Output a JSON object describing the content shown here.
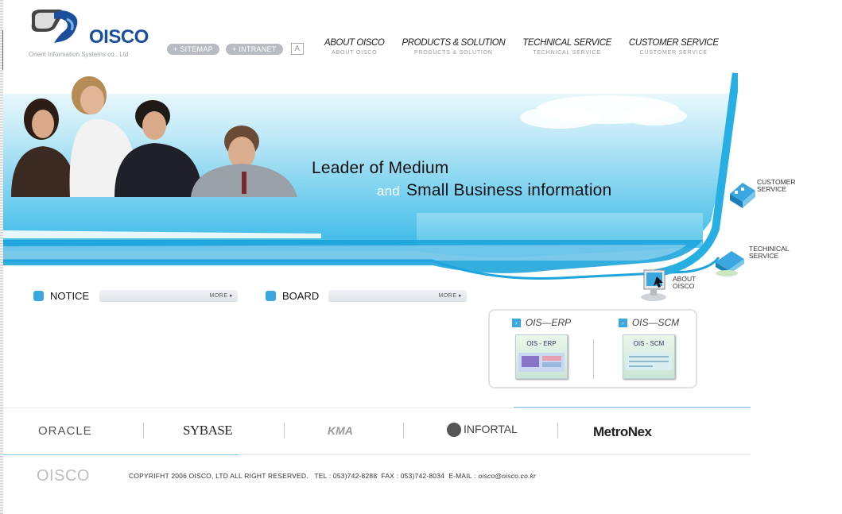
{
  "brand": {
    "name": "OISCO",
    "subtitle": "Orient Information Systems co., Ltd",
    "primary_color": "#1b4f9c",
    "accent_color": "#3aa7e0"
  },
  "utility": {
    "sitemap": "+ SITEMAP",
    "intranet": "+ INTRANET",
    "font_size_button": "A"
  },
  "nav": [
    {
      "label": "ABOUT OISCO",
      "sub": "ABOUT OISCO"
    },
    {
      "label": "PRODUCTS & SOLUTION",
      "sub": "PRODUCTS & SOLUTION"
    },
    {
      "label": "TECHNICAL SERVICE",
      "sub": "TECHNICAL SERVICE"
    },
    {
      "label": "CUSTOMER SERVICE",
      "sub": "CUSTOMER SERVICE"
    }
  ],
  "hero": {
    "line1": "Leader of Medium",
    "and": "and",
    "line2": "Small Business information"
  },
  "quick_links": {
    "customer": [
      "CUSTOMER",
      "SERVICE"
    ],
    "technical": [
      "TECHINICAL",
      "SERVICE"
    ],
    "about": [
      "ABOUT",
      "OISCO"
    ]
  },
  "boards": {
    "notice": {
      "title": "NOTICE",
      "more": "MORE ▸"
    },
    "board": {
      "title": "BOARD",
      "more": "MORE ▸"
    }
  },
  "products": {
    "erp": {
      "title": "OIS—ERP",
      "thumb": "OIS - ERP"
    },
    "scm": {
      "title": "OIS—SCM",
      "thumb": "OIS - SCM"
    }
  },
  "partners": [
    "ORACLE",
    "SYBASE",
    "KMA",
    "INFORTAL",
    "MetroNex"
  ],
  "footer": {
    "logo": "OISCO",
    "copyright": "COPYRIFHT 2006 OISCO, LTD ALL RIGHT RESERVED.",
    "tel": "TEL : 053)742-8288",
    "fax": "FAX : 053)742-8034",
    "email_label": "E-MAIL :",
    "email": "oisco@oisco.co.kr"
  }
}
